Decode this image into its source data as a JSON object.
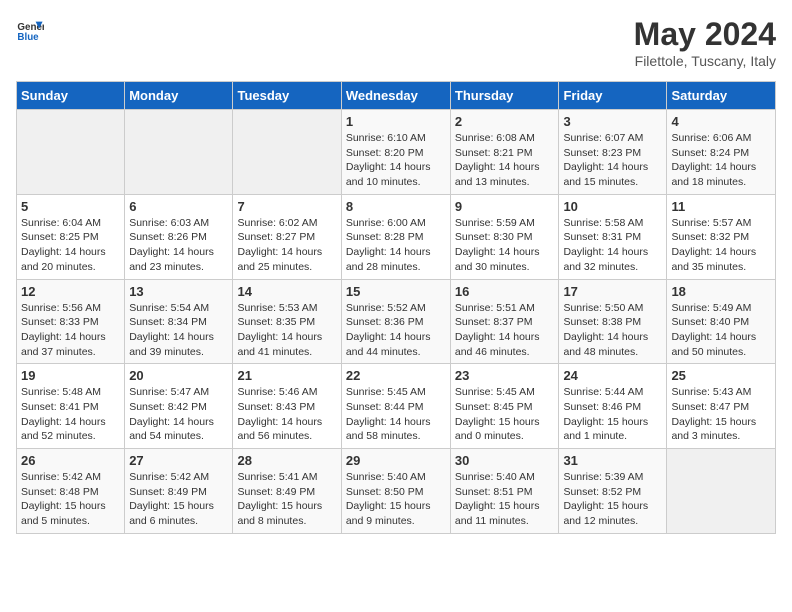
{
  "header": {
    "logo_general": "General",
    "logo_blue": "Blue",
    "title": "May 2024",
    "subtitle": "Filettole, Tuscany, Italy"
  },
  "days_of_week": [
    "Sunday",
    "Monday",
    "Tuesday",
    "Wednesday",
    "Thursday",
    "Friday",
    "Saturday"
  ],
  "weeks": [
    [
      {
        "day": "",
        "info": ""
      },
      {
        "day": "",
        "info": ""
      },
      {
        "day": "",
        "info": ""
      },
      {
        "day": "1",
        "info": "Sunrise: 6:10 AM\nSunset: 8:20 PM\nDaylight: 14 hours\nand 10 minutes."
      },
      {
        "day": "2",
        "info": "Sunrise: 6:08 AM\nSunset: 8:21 PM\nDaylight: 14 hours\nand 13 minutes."
      },
      {
        "day": "3",
        "info": "Sunrise: 6:07 AM\nSunset: 8:23 PM\nDaylight: 14 hours\nand 15 minutes."
      },
      {
        "day": "4",
        "info": "Sunrise: 6:06 AM\nSunset: 8:24 PM\nDaylight: 14 hours\nand 18 minutes."
      }
    ],
    [
      {
        "day": "5",
        "info": "Sunrise: 6:04 AM\nSunset: 8:25 PM\nDaylight: 14 hours\nand 20 minutes."
      },
      {
        "day": "6",
        "info": "Sunrise: 6:03 AM\nSunset: 8:26 PM\nDaylight: 14 hours\nand 23 minutes."
      },
      {
        "day": "7",
        "info": "Sunrise: 6:02 AM\nSunset: 8:27 PM\nDaylight: 14 hours\nand 25 minutes."
      },
      {
        "day": "8",
        "info": "Sunrise: 6:00 AM\nSunset: 8:28 PM\nDaylight: 14 hours\nand 28 minutes."
      },
      {
        "day": "9",
        "info": "Sunrise: 5:59 AM\nSunset: 8:30 PM\nDaylight: 14 hours\nand 30 minutes."
      },
      {
        "day": "10",
        "info": "Sunrise: 5:58 AM\nSunset: 8:31 PM\nDaylight: 14 hours\nand 32 minutes."
      },
      {
        "day": "11",
        "info": "Sunrise: 5:57 AM\nSunset: 8:32 PM\nDaylight: 14 hours\nand 35 minutes."
      }
    ],
    [
      {
        "day": "12",
        "info": "Sunrise: 5:56 AM\nSunset: 8:33 PM\nDaylight: 14 hours\nand 37 minutes."
      },
      {
        "day": "13",
        "info": "Sunrise: 5:54 AM\nSunset: 8:34 PM\nDaylight: 14 hours\nand 39 minutes."
      },
      {
        "day": "14",
        "info": "Sunrise: 5:53 AM\nSunset: 8:35 PM\nDaylight: 14 hours\nand 41 minutes."
      },
      {
        "day": "15",
        "info": "Sunrise: 5:52 AM\nSunset: 8:36 PM\nDaylight: 14 hours\nand 44 minutes."
      },
      {
        "day": "16",
        "info": "Sunrise: 5:51 AM\nSunset: 8:37 PM\nDaylight: 14 hours\nand 46 minutes."
      },
      {
        "day": "17",
        "info": "Sunrise: 5:50 AM\nSunset: 8:38 PM\nDaylight: 14 hours\nand 48 minutes."
      },
      {
        "day": "18",
        "info": "Sunrise: 5:49 AM\nSunset: 8:40 PM\nDaylight: 14 hours\nand 50 minutes."
      }
    ],
    [
      {
        "day": "19",
        "info": "Sunrise: 5:48 AM\nSunset: 8:41 PM\nDaylight: 14 hours\nand 52 minutes."
      },
      {
        "day": "20",
        "info": "Sunrise: 5:47 AM\nSunset: 8:42 PM\nDaylight: 14 hours\nand 54 minutes."
      },
      {
        "day": "21",
        "info": "Sunrise: 5:46 AM\nSunset: 8:43 PM\nDaylight: 14 hours\nand 56 minutes."
      },
      {
        "day": "22",
        "info": "Sunrise: 5:45 AM\nSunset: 8:44 PM\nDaylight: 14 hours\nand 58 minutes."
      },
      {
        "day": "23",
        "info": "Sunrise: 5:45 AM\nSunset: 8:45 PM\nDaylight: 15 hours\nand 0 minutes."
      },
      {
        "day": "24",
        "info": "Sunrise: 5:44 AM\nSunset: 8:46 PM\nDaylight: 15 hours\nand 1 minute."
      },
      {
        "day": "25",
        "info": "Sunrise: 5:43 AM\nSunset: 8:47 PM\nDaylight: 15 hours\nand 3 minutes."
      }
    ],
    [
      {
        "day": "26",
        "info": "Sunrise: 5:42 AM\nSunset: 8:48 PM\nDaylight: 15 hours\nand 5 minutes."
      },
      {
        "day": "27",
        "info": "Sunrise: 5:42 AM\nSunset: 8:49 PM\nDaylight: 15 hours\nand 6 minutes."
      },
      {
        "day": "28",
        "info": "Sunrise: 5:41 AM\nSunset: 8:49 PM\nDaylight: 15 hours\nand 8 minutes."
      },
      {
        "day": "29",
        "info": "Sunrise: 5:40 AM\nSunset: 8:50 PM\nDaylight: 15 hours\nand 9 minutes."
      },
      {
        "day": "30",
        "info": "Sunrise: 5:40 AM\nSunset: 8:51 PM\nDaylight: 15 hours\nand 11 minutes."
      },
      {
        "day": "31",
        "info": "Sunrise: 5:39 AM\nSunset: 8:52 PM\nDaylight: 15 hours\nand 12 minutes."
      },
      {
        "day": "",
        "info": ""
      }
    ]
  ]
}
